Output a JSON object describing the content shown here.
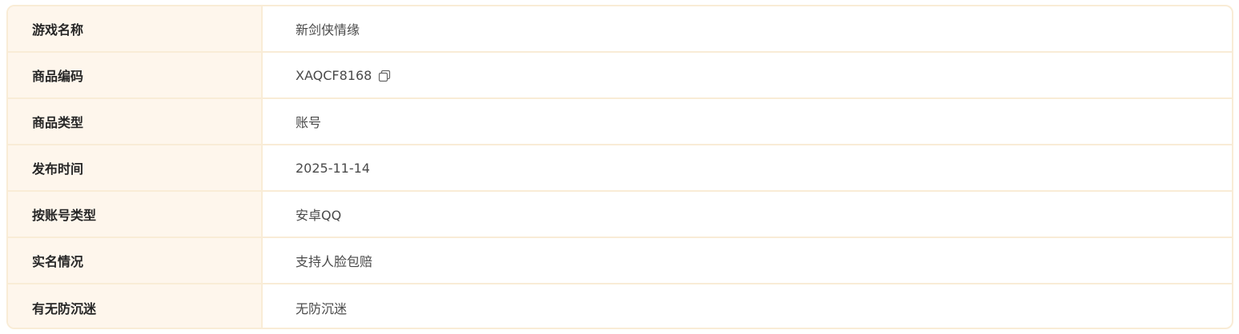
{
  "rows": [
    {
      "label": "游戏名称",
      "value": "新剑侠情缘"
    },
    {
      "label": "商品编码",
      "value": "XAQCF8168",
      "icon": "copy-icon"
    },
    {
      "label": "商品类型",
      "value": "账号"
    },
    {
      "label": "发布时间",
      "value": "2025-11-14"
    },
    {
      "label": "按账号类型",
      "value": "安卓QQ"
    },
    {
      "label": "实名情况",
      "value": "支持人脸包赔"
    },
    {
      "label": "有无防沉迷",
      "value": "无防沉迷"
    }
  ],
  "colors": {
    "border": "#f9ecd6",
    "label_bg": "#fef6ec",
    "label_text": "#262626",
    "value_text": "#4a4a4a"
  }
}
